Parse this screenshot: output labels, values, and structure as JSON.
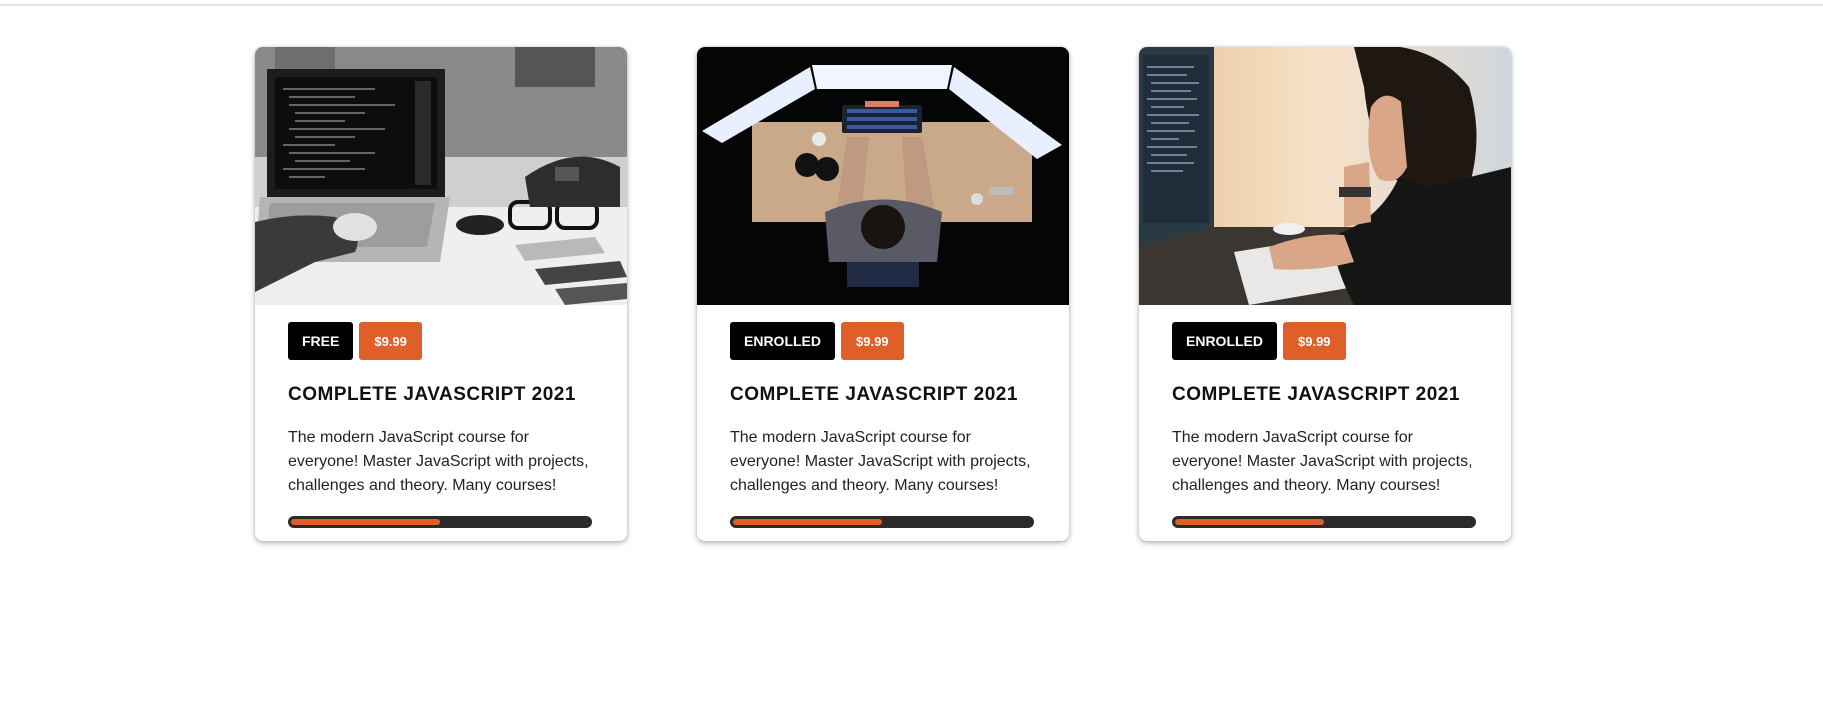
{
  "courses": [
    {
      "image_icon": "laptop-code-photo-icon",
      "status_label": "FREE",
      "price_label": "$9.99",
      "title": "COMPLETE JAVASCRIPT 2021",
      "description": "The modern JavaScript course for everyone! Master JavaScript with projects, challenges and theory. Many courses!",
      "progress": 0.5
    },
    {
      "image_icon": "desk-overhead-photo-icon",
      "status_label": "ENROLLED",
      "price_label": "$9.99",
      "title": "COMPLETE JAVASCRIPT 2021",
      "description": "The modern JavaScript course for everyone! Master JavaScript with projects, challenges and theory. Many courses!",
      "progress": 0.5
    },
    {
      "image_icon": "woman-at-computer-photo-icon",
      "status_label": "ENROLLED",
      "price_label": "$9.99",
      "title": "COMPLETE JAVASCRIPT 2021",
      "description": "The modern JavaScript course for everyone! Master JavaScript with projects, challenges and theory. Many courses!",
      "progress": 0.5
    }
  ],
  "colors": {
    "accent": "#e05f28",
    "badge_dark": "#000000",
    "track": "#2b2b2b"
  }
}
